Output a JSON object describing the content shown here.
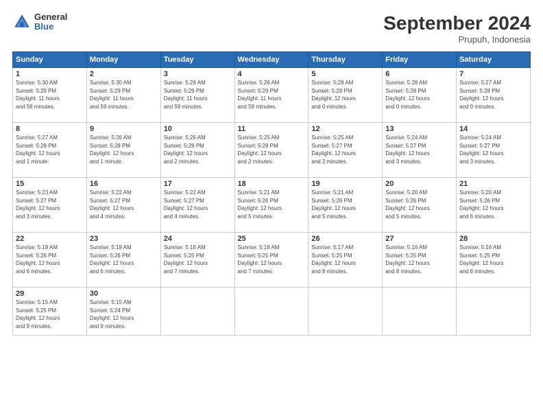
{
  "header": {
    "logo_general": "General",
    "logo_blue": "Blue",
    "month_title": "September 2024",
    "location": "Prupuh, Indonesia"
  },
  "weekdays": [
    "Sunday",
    "Monday",
    "Tuesday",
    "Wednesday",
    "Thursday",
    "Friday",
    "Saturday"
  ],
  "weeks": [
    [
      {
        "day": "1",
        "info": "Sunrise: 5:30 AM\nSunset: 5:29 PM\nDaylight: 11 hours\nand 58 minutes."
      },
      {
        "day": "2",
        "info": "Sunrise: 5:30 AM\nSunset: 5:29 PM\nDaylight: 11 hours\nand 59 minutes."
      },
      {
        "day": "3",
        "info": "Sunrise: 5:29 AM\nSunset: 5:29 PM\nDaylight: 11 hours\nand 59 minutes."
      },
      {
        "day": "4",
        "info": "Sunrise: 5:29 AM\nSunset: 5:29 PM\nDaylight: 11 hours\nand 59 minutes."
      },
      {
        "day": "5",
        "info": "Sunrise: 5:28 AM\nSunset: 5:28 PM\nDaylight: 12 hours\nand 0 minutes."
      },
      {
        "day": "6",
        "info": "Sunrise: 5:28 AM\nSunset: 5:28 PM\nDaylight: 12 hours\nand 0 minutes."
      },
      {
        "day": "7",
        "info": "Sunrise: 5:27 AM\nSunset: 5:28 PM\nDaylight: 12 hours\nand 0 minutes."
      }
    ],
    [
      {
        "day": "8",
        "info": "Sunrise: 5:27 AM\nSunset: 5:28 PM\nDaylight: 12 hours\nand 1 minute."
      },
      {
        "day": "9",
        "info": "Sunrise: 5:26 AM\nSunset: 5:28 PM\nDaylight: 12 hours\nand 1 minute."
      },
      {
        "day": "10",
        "info": "Sunrise: 5:26 AM\nSunset: 5:28 PM\nDaylight: 12 hours\nand 2 minutes."
      },
      {
        "day": "11",
        "info": "Sunrise: 5:25 AM\nSunset: 5:28 PM\nDaylight: 12 hours\nand 2 minutes."
      },
      {
        "day": "12",
        "info": "Sunrise: 5:25 AM\nSunset: 5:27 PM\nDaylight: 12 hours\nand 2 minutes."
      },
      {
        "day": "13",
        "info": "Sunrise: 5:24 AM\nSunset: 5:27 PM\nDaylight: 12 hours\nand 3 minutes."
      },
      {
        "day": "14",
        "info": "Sunrise: 5:24 AM\nSunset: 5:27 PM\nDaylight: 12 hours\nand 3 minutes."
      }
    ],
    [
      {
        "day": "15",
        "info": "Sunrise: 5:23 AM\nSunset: 5:27 PM\nDaylight: 12 hours\nand 3 minutes."
      },
      {
        "day": "16",
        "info": "Sunrise: 5:22 AM\nSunset: 5:27 PM\nDaylight: 12 hours\nand 4 minutes."
      },
      {
        "day": "17",
        "info": "Sunrise: 5:22 AM\nSunset: 5:27 PM\nDaylight: 12 hours\nand 4 minutes."
      },
      {
        "day": "18",
        "info": "Sunrise: 5:21 AM\nSunset: 5:26 PM\nDaylight: 12 hours\nand 5 minutes."
      },
      {
        "day": "19",
        "info": "Sunrise: 5:21 AM\nSunset: 5:26 PM\nDaylight: 12 hours\nand 5 minutes."
      },
      {
        "day": "20",
        "info": "Sunrise: 5:20 AM\nSunset: 5:26 PM\nDaylight: 12 hours\nand 5 minutes."
      },
      {
        "day": "21",
        "info": "Sunrise: 5:20 AM\nSunset: 5:26 PM\nDaylight: 12 hours\nand 6 minutes."
      }
    ],
    [
      {
        "day": "22",
        "info": "Sunrise: 5:19 AM\nSunset: 5:26 PM\nDaylight: 12 hours\nand 6 minutes."
      },
      {
        "day": "23",
        "info": "Sunrise: 5:19 AM\nSunset: 5:26 PM\nDaylight: 12 hours\nand 6 minutes."
      },
      {
        "day": "24",
        "info": "Sunrise: 5:18 AM\nSunset: 5:25 PM\nDaylight: 12 hours\nand 7 minutes."
      },
      {
        "day": "25",
        "info": "Sunrise: 5:18 AM\nSunset: 5:25 PM\nDaylight: 12 hours\nand 7 minutes."
      },
      {
        "day": "26",
        "info": "Sunrise: 5:17 AM\nSunset: 5:25 PM\nDaylight: 12 hours\nand 8 minutes."
      },
      {
        "day": "27",
        "info": "Sunrise: 5:16 AM\nSunset: 5:25 PM\nDaylight: 12 hours\nand 8 minutes."
      },
      {
        "day": "28",
        "info": "Sunrise: 5:16 AM\nSunset: 5:25 PM\nDaylight: 12 hours\nand 8 minutes."
      }
    ],
    [
      {
        "day": "29",
        "info": "Sunrise: 5:15 AM\nSunset: 5:25 PM\nDaylight: 12 hours\nand 9 minutes."
      },
      {
        "day": "30",
        "info": "Sunrise: 5:15 AM\nSunset: 5:24 PM\nDaylight: 12 hours\nand 9 minutes."
      },
      {
        "day": "",
        "info": ""
      },
      {
        "day": "",
        "info": ""
      },
      {
        "day": "",
        "info": ""
      },
      {
        "day": "",
        "info": ""
      },
      {
        "day": "",
        "info": ""
      }
    ]
  ]
}
